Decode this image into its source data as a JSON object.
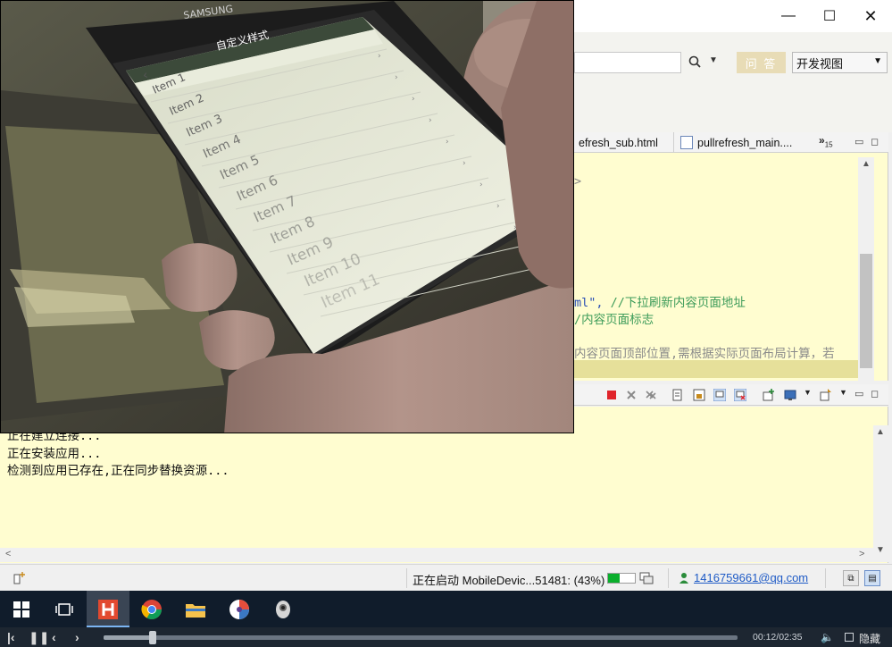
{
  "window": {
    "controls": {
      "minimize": "—",
      "maximize": "☐",
      "close": "✕"
    }
  },
  "toolbar": {
    "search_placeholder": "",
    "qa_button": "问 答",
    "view_select": "开发视图",
    "icons": {
      "search": "search-icon",
      "dropdown": "chevron-down-icon"
    }
  },
  "editor": {
    "tabs": [
      {
        "label": "efresh_sub.html"
      },
      {
        "label": "pullrefresh_main...."
      }
    ],
    "tab_overflow": "»",
    "tab_overflow_count": "15",
    "code": {
      "line1": ">",
      "line2_str": "ml\",",
      "line2_comment": "//下拉刷新内容页面地址",
      "line3_comment": "/内容页面标志",
      "line4_comment": "内容页面顶部位置,需根据实际页面布局计算，若"
    }
  },
  "console": {
    "lines": [
      "正在建立连接...",
      "正在安装应用...",
      "检测到应用已存在,正在同步替换资源..."
    ]
  },
  "statusbar": {
    "status_text": "正在启动 MobileDevic...51481: (43%)",
    "progress_percent": 43,
    "user_email": "1416759661@qq.com"
  },
  "taskbar": {
    "items": [
      "windows-start-icon",
      "task-view-icon",
      "hbuilder-icon",
      "chrome-icon",
      "file-explorer-icon",
      "app-icon",
      "camera-app-icon"
    ]
  },
  "player": {
    "time": "00:12/02:35",
    "position_fraction": 0.077,
    "hide_label": "隐藏"
  },
  "camera": {
    "phone_brand": "SAMSUNG",
    "header_title": "自定义样式",
    "list_items": [
      "Item 1",
      "Item 2",
      "Item 3",
      "Item 4",
      "Item 5",
      "Item 6",
      "Item 7",
      "Item 8",
      "Item 9",
      "Item 10",
      "Item 11"
    ]
  },
  "colors": {
    "editor_bg": "#fffdd0",
    "highlight": "#e6e09a",
    "taskbar": "#101c2b",
    "progress_fill": "#0aaf2c",
    "link": "#1f5bc6"
  }
}
